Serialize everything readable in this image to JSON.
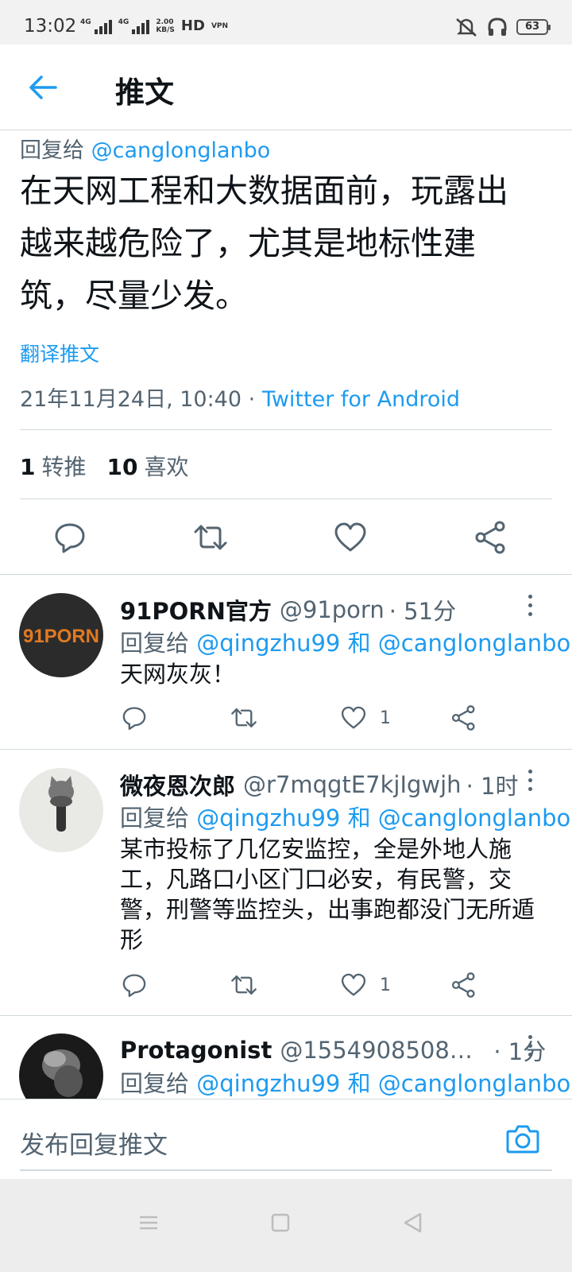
{
  "status_bar": {
    "time": "13:02",
    "net1": "4G",
    "net2": "4G",
    "speed_value": "2.00",
    "speed_unit": "KB/S",
    "hd": "HD",
    "vpn": "VPN",
    "battery": "63"
  },
  "header": {
    "title": "推文"
  },
  "tweet": {
    "reply_prefix": "回复给",
    "reply_handle": "@canglonglanbo",
    "text_line1": "在天网工程和大数据面前，玩露出",
    "text_line2": "越来越危险了，尤其是地标性建",
    "text_line3": "筑，尽量少发。",
    "translate": "翻译推文",
    "datetime": "21年11月24日, 10:40",
    "separator": "·",
    "source": "Twitter for Android",
    "retweet_count": "1",
    "retweet_label": "转推",
    "like_count": "10",
    "like_label": "喜欢"
  },
  "replies": [
    {
      "name": "91PORN官方",
      "handle": "@91porn",
      "time": "· 51分",
      "reply_prefix": "回复给",
      "reply_users": "@qingzhu99 和 @canglonglanbo",
      "text": "天网灰灰！",
      "like_count": "1",
      "avatar_text": "91PORN"
    },
    {
      "name": "微夜恩次郎",
      "handle": "@r7mqgtE7kjIgwjh",
      "time": "· 1时",
      "reply_prefix": "回复给",
      "reply_users": "@qingzhu99 和 @canglonglanbo",
      "text_line1": "某市投标了几亿安监控，全是外地人施",
      "text_line2": "工，凡路口小区门口必安，有民警，交",
      "text_line3": "警，刑警等监控头，出事跑都没门无所遁",
      "text_line4": "形",
      "like_count": "1"
    },
    {
      "name": "Protagonist",
      "handle": "@1554908508qq...",
      "time": "· 1分",
      "reply_prefix": "回复给",
      "reply_users": "@qingzhu99 和 @canglonglanbo"
    }
  ],
  "compose": {
    "placeholder": "发布回复推文"
  },
  "colors": {
    "accent": "#1d9bf0",
    "secondary_text": "#536471",
    "divider": "#cfd9de"
  },
  "icons": [
    "back-arrow-icon",
    "reply-icon",
    "retweet-icon",
    "like-icon",
    "share-icon",
    "more-icon",
    "camera-icon",
    "nav-menu-icon",
    "nav-home-icon",
    "nav-back-icon"
  ]
}
